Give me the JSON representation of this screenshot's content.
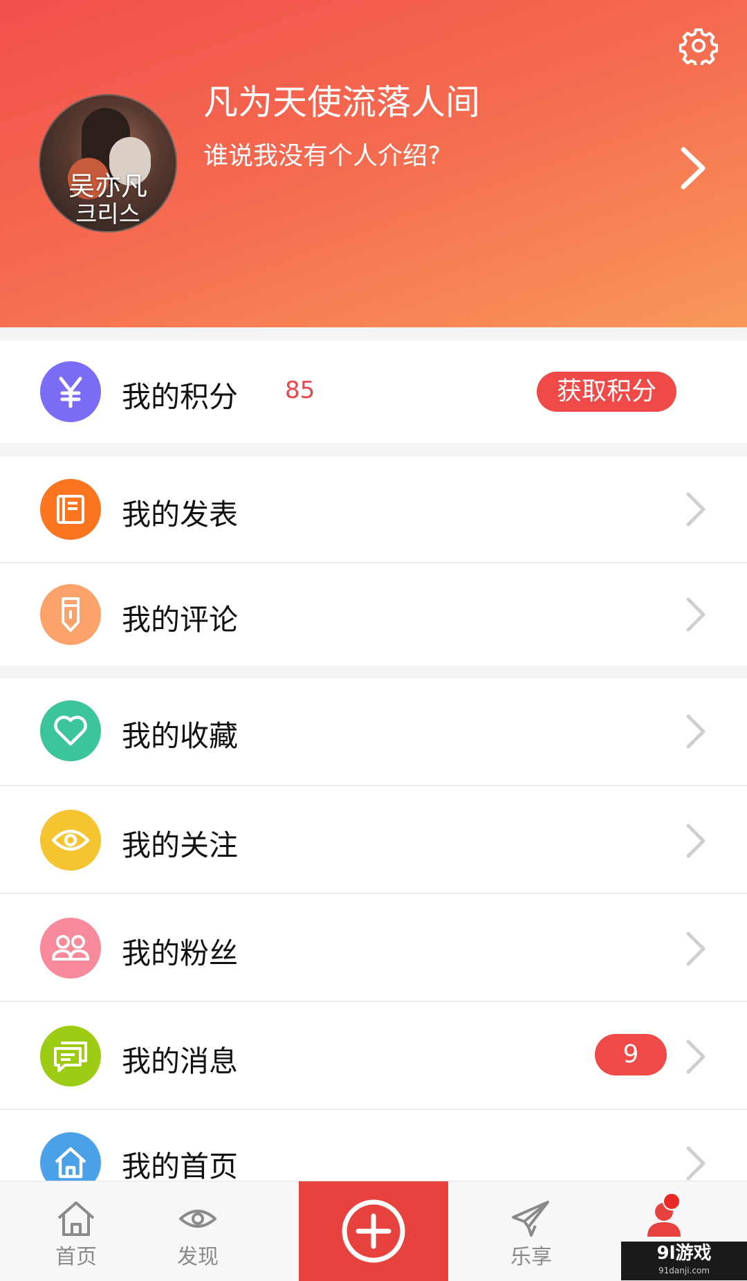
{
  "profile": {
    "username": "凡为天使流落人间",
    "bio": "谁说我没有个人介绍?",
    "avatar_text_line1": "吴亦凡",
    "avatar_text_line2": "크리스"
  },
  "points": {
    "label": "我的积分",
    "value": "85",
    "button_label": "获取积分"
  },
  "menu": {
    "posts": "我的发表",
    "comments": "我的评论",
    "favorites": "我的收藏",
    "following": "我的关注",
    "fans": "我的粉丝",
    "messages": "我的消息",
    "messages_badge": "9",
    "homepage": "我的首页"
  },
  "tabbar": {
    "home": "首页",
    "discover": "发现",
    "share": "乐享"
  },
  "watermark": {
    "brand": "9l游戏",
    "url": "91danji.com"
  },
  "colors": {
    "header_start": "#f2504c",
    "header_end": "#f9985a",
    "accent_red": "#ef4a48",
    "points_icon": "#7b6cf6",
    "posts_icon": "#fb7420",
    "comments_icon": "#fba36a",
    "favorites_icon": "#3cc59d",
    "following_icon": "#f6c331",
    "fans_icon": "#f78a9b",
    "messages_icon": "#9ecb14",
    "homepage_icon": "#4aa1e8"
  },
  "icons": {
    "settings": "gear-icon",
    "points": "yen-icon",
    "posts": "book-icon",
    "comments": "pencil-icon",
    "favorites": "heart-icon",
    "following": "eye-icon",
    "fans": "users-icon",
    "messages": "chat-icon",
    "homepage": "house-icon"
  }
}
